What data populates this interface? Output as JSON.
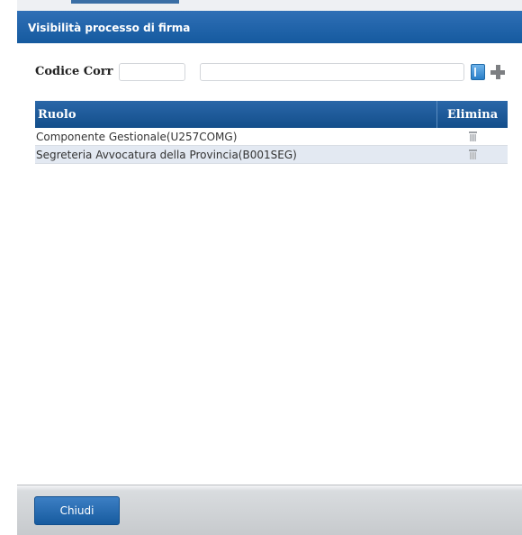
{
  "dialog": {
    "title": "Visibilità processo di firma"
  },
  "form": {
    "codice_label": "Codice Corr",
    "codice_value": "",
    "descrizione_value": ""
  },
  "grid": {
    "columns": [
      "Ruolo",
      "Elimina"
    ],
    "rows": [
      {
        "ruolo": "Componente Gestionale(U257COMG)"
      },
      {
        "ruolo": "Segreteria Avvocatura della Provincia(B001SEG)"
      }
    ]
  },
  "footer": {
    "close_label": "Chiudi"
  },
  "colors": {
    "titlebar": "#155a9f",
    "header": "#134e8b",
    "button": "#175b9f",
    "row_alt": "#e3e9f2"
  },
  "icons": {
    "rubrica": "address-book-icon",
    "add": "plus-icon",
    "delete": "trash-icon"
  }
}
